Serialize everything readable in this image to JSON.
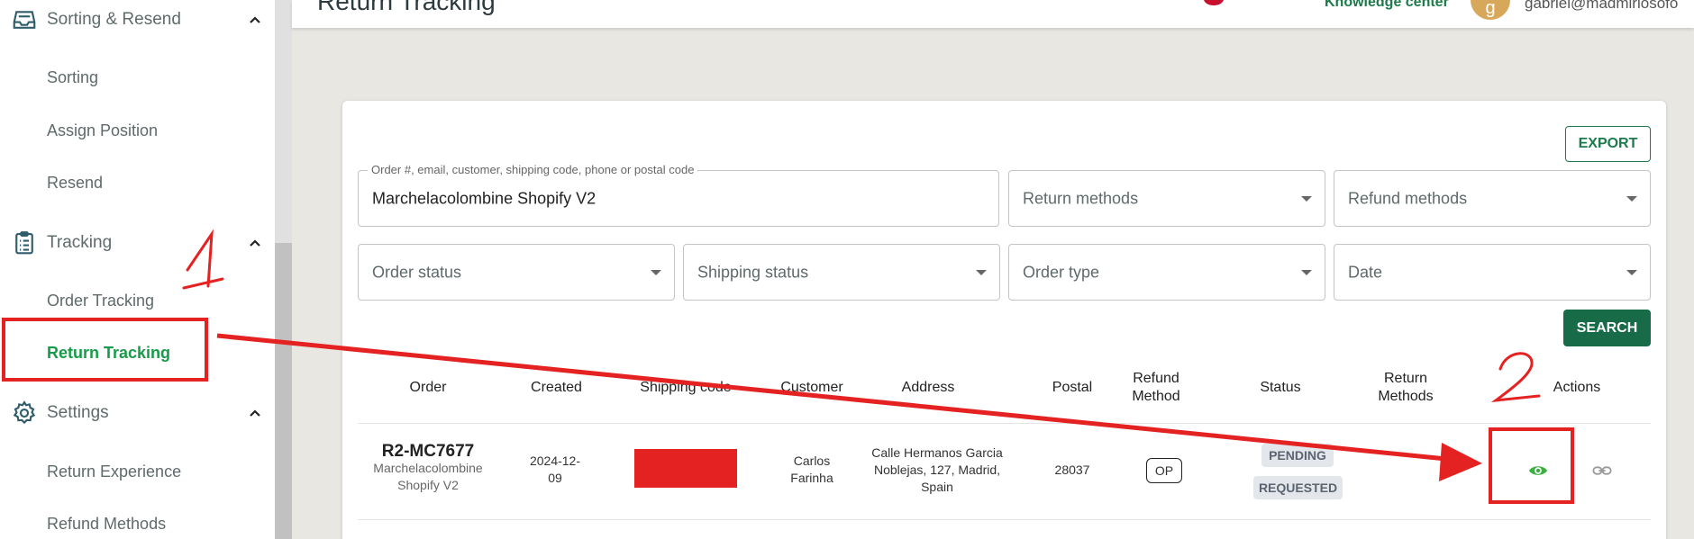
{
  "sidebar": {
    "sections": [
      {
        "label": "Sorting & Resend",
        "icon": "inbox-tray-icon",
        "expanded": true,
        "items": [
          {
            "label": "Sorting"
          },
          {
            "label": "Assign Position"
          },
          {
            "label": "Resend"
          }
        ]
      },
      {
        "label": "Tracking",
        "icon": "clipboard-list-icon",
        "expanded": true,
        "items": [
          {
            "label": "Order Tracking"
          },
          {
            "label": "Return Tracking",
            "active": true
          }
        ]
      },
      {
        "label": "Settings",
        "icon": "gear-icon",
        "expanded": true,
        "items": [
          {
            "label": "Return Experience"
          },
          {
            "label": "Refund Methods"
          }
        ]
      }
    ]
  },
  "header": {
    "title": "Return Tracking",
    "flag_icon": "uk-flag-icon",
    "knowledge_center": "Knowledge center",
    "avatar_letter": "g",
    "user_email": "gabriel@madmirlosofo"
  },
  "toolbar": {
    "export_label": "EXPORT",
    "search_label": "SEARCH"
  },
  "filters": {
    "search": {
      "legend": "Order #, email, customer, shipping code, phone or postal code",
      "value": "Marchelacolombine Shopify V2"
    },
    "return_methods": "Return methods",
    "refund_methods": "Refund methods",
    "order_status": "Order status",
    "shipping_status": "Shipping status",
    "order_type": "Order type",
    "date": "Date"
  },
  "table": {
    "headers": {
      "order": "Order",
      "created": "Created",
      "shipping_code": "Shipping code",
      "customer": "Customer",
      "address": "Address",
      "postal": "Postal",
      "refund_method_1": "Refund",
      "refund_method_2": "Method",
      "status": "Status",
      "return_methods_1": "Return",
      "return_methods_2": "Methods",
      "actions": "Actions"
    },
    "rows": [
      {
        "order_id": "R2-MC7677",
        "shop_1": "Marchelacolombine",
        "shop_2": "Shopify V2",
        "created_1": "2024-12-",
        "created_2": "09",
        "customer_1": "Carlos",
        "customer_2": "Farinha",
        "address_1": "Calle Hermanos Garcia",
        "address_2": "Noblejas, 127, Madrid,",
        "address_3": "Spain",
        "postal": "28037",
        "refund_method": "OP",
        "status_1": "PENDING",
        "status_2": "REQUESTED"
      }
    ]
  },
  "annotations": {
    "step_1": "1",
    "step_2": "2"
  },
  "colors": {
    "accent": "#169c48",
    "primary_button": "#176b47",
    "annotation": "#e52222"
  }
}
